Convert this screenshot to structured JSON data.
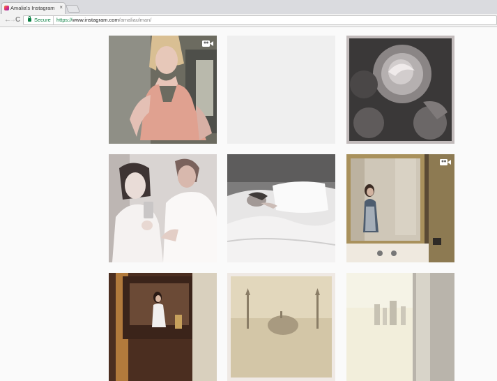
{
  "browser": {
    "tab": {
      "title": "Amalia's Instagram (@",
      "close": "×"
    },
    "address": {
      "secure_label": "Secure",
      "scheme": "https://",
      "domain": "www.instagram.com",
      "path": "/amaliaulman/"
    },
    "nav": {
      "back": "←",
      "forward": "→",
      "reload": "C"
    }
  },
  "grid": {
    "posts": [
      {
        "label": "photo-woman-pink-dress",
        "video": true
      },
      {
        "label": "photo-placeholder-blank",
        "video": false
      },
      {
        "label": "photo-dark-roses",
        "video": false
      },
      {
        "label": "photo-couple-bathrobes-mirror-selfie",
        "video": false
      },
      {
        "label": "photo-woman-in-bed",
        "video": false
      },
      {
        "label": "photo-mirror-selfie-bathroom",
        "video": true
      },
      {
        "label": "photo-woman-in-hallway",
        "video": false
      },
      {
        "label": "photo-mosque-skyline",
        "video": false
      },
      {
        "label": "photo-city-skyline-haze",
        "video": false
      }
    ]
  },
  "colors": {
    "secure_green": "#0b8043",
    "page_bg": "#fafafa"
  }
}
